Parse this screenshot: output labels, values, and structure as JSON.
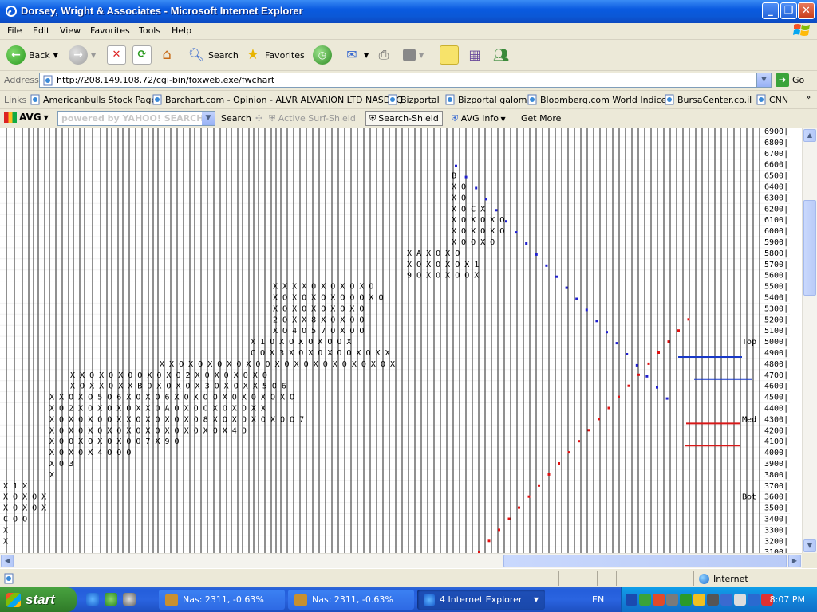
{
  "window": {
    "title": "Dorsey, Wright & Associates - Microsoft Internet Explorer",
    "minimize": "_",
    "maximize": "❐",
    "close": "✕"
  },
  "menu": [
    "File",
    "Edit",
    "View",
    "Favorites",
    "Tools",
    "Help"
  ],
  "toolbar": {
    "back": "Back",
    "search": "Search",
    "favorites": "Favorites"
  },
  "address": {
    "label": "Address",
    "url": "http://208.149.108.72/cgi-bin/foxweb.exe/fwchart",
    "go": "Go"
  },
  "links": {
    "label": "Links",
    "items": [
      "Americanbulls Stock Page",
      "Barchart.com - Opinion - ALVR ALVARION LTD NASDAQ",
      "Bizportal",
      "Bizportal galom",
      "Bloomberg.com World Indices",
      "BursaCenter.co.il",
      "CNN"
    ]
  },
  "avg_bar": {
    "logo": "AVG",
    "search_placeholder": "powered by YAHOO! SEARCH",
    "search": "Search",
    "active_surf": "Active Surf-Shield",
    "search_shield": "Search-Shield",
    "avg_info": "AVG Info",
    "get_more": "Get More"
  },
  "chart_data": {
    "type": "point-and-figure",
    "y_axis_labels": [
      "6900",
      "6800",
      "6700",
      "6600",
      "6500",
      "6400",
      "6300",
      "6200",
      "6100",
      "6000",
      "5900",
      "5800",
      "5700",
      "5600",
      "5500",
      "5400",
      "5300",
      "5200",
      "5100",
      "5000",
      "4900",
      "4800",
      "4700",
      "4600",
      "4500",
      "4400",
      "4300",
      "4200",
      "4100",
      "4000",
      "3900",
      "3800",
      "3700",
      "3600",
      "3500",
      "3400",
      "3300",
      "3200",
      "3100"
    ],
    "annotations": [
      {
        "text": "Top",
        "level": 5000
      },
      {
        "text": "Med",
        "level": 4300
      },
      {
        "text": "Bot",
        "level": 3600
      }
    ],
    "grid_text_rows": [
      {
        "level": 6500,
        "text": "B"
      },
      {
        "level": 6400,
        "text": "X O"
      },
      {
        "level": 6300,
        "text": "X O"
      },
      {
        "level": 6200,
        "text": "X O C  X"
      },
      {
        "level": 6100,
        "text": "X O X O X O"
      },
      {
        "level": 6000,
        "text": "X O X O X O"
      },
      {
        "level": 5900,
        "text": "X O    O X O"
      },
      {
        "level": 5800,
        "text": "X    A X    O X O"
      },
      {
        "level": 5700,
        "text": "X O X O X   O X 1"
      },
      {
        "level": 5600,
        "text": "9 O X O X   O   O X"
      },
      {
        "level": 5500,
        "text": "X   X   X   X O X O X   O X O"
      },
      {
        "level": 5400,
        "text": "X O   X O X O X O   O   O X O"
      },
      {
        "level": 5300,
        "text": "X O   X O X O X   O X O"
      },
      {
        "level": 5200,
        "text": "2 O X   X 8 X O X   O   O"
      },
      {
        "level": 5100,
        "text": "X O 4 O 5   7 O X O   O"
      },
      {
        "level": 5000,
        "text": "X   1 O X O X O   X O   O X"
      },
      {
        "level": 4900,
        "text": "C O X 3 X O X O   X O   O X O X   X"
      },
      {
        "level": 4800,
        "text": "X   X O   X O X O X O X O   O X O   X O X   O X O X O X O X"
      },
      {
        "level": 4700,
        "text": "X   X O   X O   X O   O X O X   O   2 X O X O X O   X O"
      },
      {
        "level": 4600,
        "text": "X O X   X O X   X   B   O X O X   O X 3   O X O X   X   5 O 6"
      },
      {
        "level": 4500,
        "text": "X   X O X O   5 O 6   X O X   O   6 X   O X   O   O X O X O X O X O"
      },
      {
        "level": 4400,
        "text": "X O 2 X O   X O X O X   X O A   O X O   O X O X O X   X"
      },
      {
        "level": 4300,
        "text": "X O X O X O   O   X   X O X O X O X O 8 X   O X O X O X O   O   7"
      },
      {
        "level": 4200,
        "text": "X O X   O X O X O X O X O X O X O X O X   4   O"
      },
      {
        "level": 4100,
        "text": "X O   O X O X O X O   O 7 X 9   O"
      },
      {
        "level": 4000,
        "text": "X   O X O X 4   O   O   O"
      },
      {
        "level": 3900,
        "text": "X   O   3"
      },
      {
        "level": 3800,
        "text": "X"
      },
      {
        "level": 3700,
        "text": "X   1   X"
      },
      {
        "level": 3600,
        "text": "X O X O X"
      },
      {
        "level": 3500,
        "text": "X O X O X"
      },
      {
        "level": 3400,
        "text": "C O   O"
      },
      {
        "level": 3300,
        "text": "X"
      },
      {
        "level": 3200,
        "text": "X"
      }
    ]
  },
  "status": {
    "zone": "Internet"
  },
  "taskbar": {
    "start": "start",
    "buttons": [
      {
        "label": "Nas: 2311, -0.63%"
      },
      {
        "label": "Nas: 2311, -0.63%"
      },
      {
        "label": "4 Internet Explorer"
      }
    ],
    "language": "EN",
    "clock": "8:07 PM"
  },
  "colors": {
    "blue_dot": "#2020d0",
    "red_dot": "#e01010",
    "trend_line_blue": "#1838c8",
    "trend_line_red": "#d81818",
    "chart_text": "#000000",
    "chart_blue_text": "#2020a0"
  }
}
